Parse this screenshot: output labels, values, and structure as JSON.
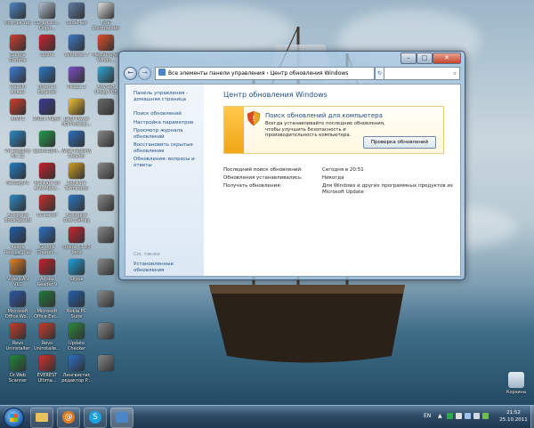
{
  "desktop": {
    "icons": [
      {
        "label": "Компьютер",
        "color": "#4a86c8",
        "icon": "computer-icon"
      },
      {
        "label": "CD-диско... Оnpu...",
        "color": "#b0bfd0",
        "icon": "cd-icon"
      },
      {
        "label": "SlideMeb",
        "color": "#5e7ea8",
        "icon": "app-icon"
      },
      {
        "label": "Total Commander",
        "color": "#e0e0e0",
        "icon": "floppy-icon"
      },
      {
        "label": "Google Chrome",
        "color": "#d23b2f",
        "icon": "chrome-icon"
      },
      {
        "label": "Opera",
        "color": "#d2202f",
        "icon": "opera-icon"
      },
      {
        "label": "Windows 7",
        "color": "#3a7ac8",
        "icon": "app-icon"
      },
      {
        "label": "MediaPlayer Windo...",
        "color": "#e34c26",
        "icon": "media-icon"
      },
      {
        "label": "Wakelu Алкан",
        "color": "#3d7bd9",
        "icon": "app-icon"
      },
      {
        "label": "Internet Explorer",
        "color": "#2a78c8",
        "icon": "ie-icon"
      },
      {
        "label": "Picasa 3",
        "color": "#7c4dc8",
        "icon": "picasa-icon"
      },
      {
        "label": "AnvSoft Unsig PCE",
        "color": "#2aa8d8",
        "icon": "app-icon"
      },
      {
        "label": "AIMP2",
        "color": "#d43a2a",
        "icon": "aimp-icon"
      },
      {
        "label": "DVDx Player",
        "color": "#3a3a9a",
        "icon": "dvd-icon"
      },
      {
        "label": "DVD Player HD Professi...",
        "color": "#f2c230",
        "icon": "dvd-icon"
      },
      {
        "label": "",
        "color": "#6a6a6a",
        "icon": "tools-icon"
      },
      {
        "label": "Vit Registry Fix 12",
        "color": "#2a88c8",
        "icon": "registry-icon"
      },
      {
        "label": "SpeedUpM...",
        "color": "#1f9e4a",
        "icon": "speed-icon"
      },
      {
        "label": "Wise Registry Cleaner",
        "color": "#2a6fc0",
        "icon": "registry-icon"
      },
      {
        "label": "",
        "color": "#888",
        "icon": "app-icon"
      },
      {
        "label": "NeoSpyPC",
        "color": "#1e7ec8",
        "icon": "app-icon"
      },
      {
        "label": "Malware by Anti-Malw...",
        "color": "#c81e28",
        "icon": "shield-icon"
      },
      {
        "label": "Spyware Terminator",
        "color": "#d2a020",
        "icon": "shield-icon"
      },
      {
        "label": "",
        "color": "#888",
        "icon": "app-icon"
      },
      {
        "label": "Auslogics BoostSpeed",
        "color": "#2a88c8",
        "icon": "app-icon"
      },
      {
        "label": "CCleaner",
        "color": "#c8302a",
        "icon": "ccleaner-icon"
      },
      {
        "label": "Auslogics Disk Defrag",
        "color": "#2a78c8",
        "icon": "defrag-icon"
      },
      {
        "label": "",
        "color": "#888",
        "icon": "app-icon"
      },
      {
        "label": "Kaspe Rescue Disk PRO",
        "color": "#1d5ea8",
        "icon": "app-icon"
      },
      {
        "label": "Google Планет...",
        "color": "#2a6fc8",
        "icon": "earth-icon"
      },
      {
        "label": "Opera 11.50 beta",
        "color": "#d2202f",
        "icon": "opera-icon"
      },
      {
        "label": "",
        "color": "#888",
        "icon": "app-icon"
      },
      {
        "label": "VideoLAN VLC",
        "color": "#e67e22",
        "icon": "vlc-icon"
      },
      {
        "label": "Adobe Reader 9",
        "color": "#c81e28",
        "icon": "pdf-icon"
      },
      {
        "label": "Skype",
        "color": "#1ba1e2",
        "icon": "skype-icon"
      },
      {
        "label": "",
        "color": "#888",
        "icon": "app-icon"
      },
      {
        "label": "Microsoft Office Wo...",
        "color": "#2a56a8",
        "icon": "word-icon"
      },
      {
        "label": "Microsoft Office Exc...",
        "color": "#1f7a3a",
        "icon": "excel-icon"
      },
      {
        "label": "Nokia PC Suite",
        "color": "#1f5fb0",
        "icon": "app-icon"
      },
      {
        "label": "",
        "color": "#888",
        "icon": "app-icon"
      },
      {
        "label": "Revo Uninstaller",
        "color": "#c83a2a",
        "icon": "uninstall-icon"
      },
      {
        "label": "Revo Uninstalle...",
        "color": "#c83a2a",
        "icon": "uninstall-icon"
      },
      {
        "label": "Update Checker",
        "color": "#2a8a3a",
        "icon": "update-icon"
      },
      {
        "label": "",
        "color": "#888",
        "icon": "app-icon"
      },
      {
        "label": "Dr.Web Scanner",
        "color": "#1d8a3a",
        "icon": "drweb-icon"
      },
      {
        "label": "EVEREST Ultima...",
        "color": "#d2302a",
        "icon": "everest-icon"
      },
      {
        "label": "Лингвистис редактор P...",
        "color": "#2a6fc8",
        "icon": "app-icon"
      },
      {
        "label": "",
        "color": "#888",
        "icon": "app-icon"
      }
    ],
    "recycle_label": "Корзина"
  },
  "window": {
    "address": "Все элементы панели управления  ›  Центр обновления Windows",
    "search_placeholder": "",
    "sidebar": {
      "home": "Панель управления - домашняя страница",
      "links": [
        "Поиск обновлений",
        "Настройка параметров",
        "Просмотр журнала обновлений",
        "Восстановить скрытые обновления",
        "Обновления: вопросы и ответы"
      ],
      "see_also": "См. также",
      "installed": "Установленные обновления"
    },
    "main": {
      "title": "Центр обновления Windows",
      "panel_title": "Поиск обновлений для компьютера",
      "panel_text": "Всегда устанавливайте последние обновления, чтобы улучшить безопасность и производительность компьютера.",
      "panel_button": "Проверка обновлений",
      "info": [
        {
          "label": "Последний поиск обновлений:",
          "value": "Сегодня в 20:51"
        },
        {
          "label": "Обновления устанавливались:",
          "value": "Никогда"
        },
        {
          "label": "Получать обновления:",
          "value": "Для Windows и других программных продуктов из Microsoft Update"
        }
      ]
    }
  },
  "taskbar": {
    "lang": "EN",
    "time": "21:52",
    "date": "25.10.2011"
  }
}
